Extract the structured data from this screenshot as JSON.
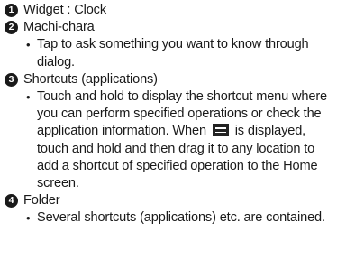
{
  "items": [
    {
      "number": "1",
      "title": "Widget : Clock"
    },
    {
      "number": "2",
      "title": "Machi-chara",
      "bullet": "Tap to ask something you want to know through dialog."
    },
    {
      "number": "3",
      "title": "Shortcuts (applications)",
      "bullet_before_icon": "Touch and hold to display the shortcut menu where you can perform specified operations or check the application information. When",
      "bullet_icon": "menu-icon",
      "bullet_after_icon": "is displayed, touch and hold and then drag it to any location to add a shortcut of specified operation to the Home screen."
    },
    {
      "number": "4",
      "title": "Folder",
      "bullet": "Several shortcuts (applications) etc. are contained."
    }
  ],
  "bullet_char": "•"
}
